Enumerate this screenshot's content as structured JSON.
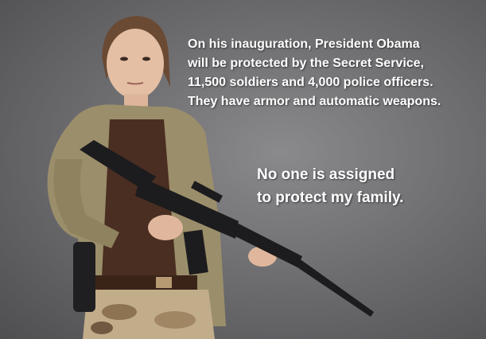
{
  "caption_top": {
    "lines": [
      "On his inauguration, President Obama",
      "will be protected by the Secret Service,",
      "11,500 soldiers and 4,000 police officers.",
      "They have armor and automatic weapons."
    ]
  },
  "caption_bottom": {
    "lines": [
      "No one is assigned",
      "to protect my family."
    ]
  },
  "colors": {
    "background": "#6f6f72",
    "caption_text": "#ffffff",
    "jacket": "#9b8e6a",
    "shirt": "#4a2e22",
    "rifle": "#1c1c1e"
  }
}
